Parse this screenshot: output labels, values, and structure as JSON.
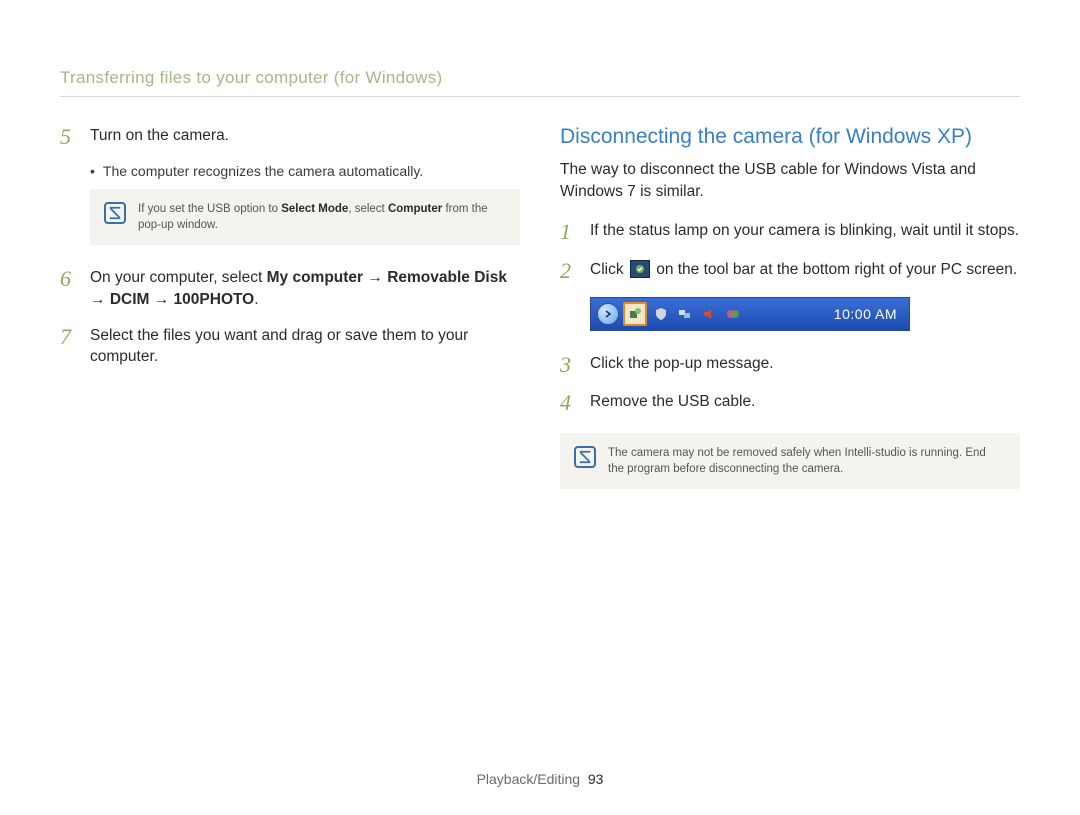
{
  "header": "Transferring files to your computer (for Windows)",
  "left": {
    "steps": [
      {
        "num": "5",
        "text_plain": "Turn on the camera."
      },
      {
        "num": "6",
        "html": "On your computer, select <b>My computer</b> <span class='arrow'>→</span> <b>Removable Disk</b> <span class='arrow'>→</span> <b>DCIM</b> <span class='arrow'>→</span> <b>100PHOTO</b>."
      },
      {
        "num": "7",
        "text_plain": "Select the files you want and drag or save them to your computer."
      }
    ],
    "sub_bullet": "The computer recognizes the camera automatically.",
    "note_html": "If you set the USB option to <b>Select Mode</b>, select <b>Computer</b> from the pop-up window."
  },
  "right": {
    "title": "Disconnecting the camera (for Windows XP)",
    "intro": "The way to disconnect the USB cable for Windows Vista and Windows 7 is similar.",
    "steps": [
      {
        "num": "1",
        "text_plain": "If the status lamp on your camera is blinking, wait until it stops."
      },
      {
        "num": "2",
        "html_before": "Click ",
        "html_after": " on the tool bar at the bottom right of your PC screen.",
        "has_inline_icon": true
      },
      {
        "num": "3",
        "text_plain": "Click the pop-up message."
      },
      {
        "num": "4",
        "text_plain": "Remove the USB cable."
      }
    ],
    "taskbar": {
      "time": "10:00 AM"
    },
    "note": "The camera may not be removed safely when Intelli-studio is running. End the program before disconnecting the camera."
  },
  "footer": {
    "section": "Playback/Editing",
    "page": "93"
  }
}
